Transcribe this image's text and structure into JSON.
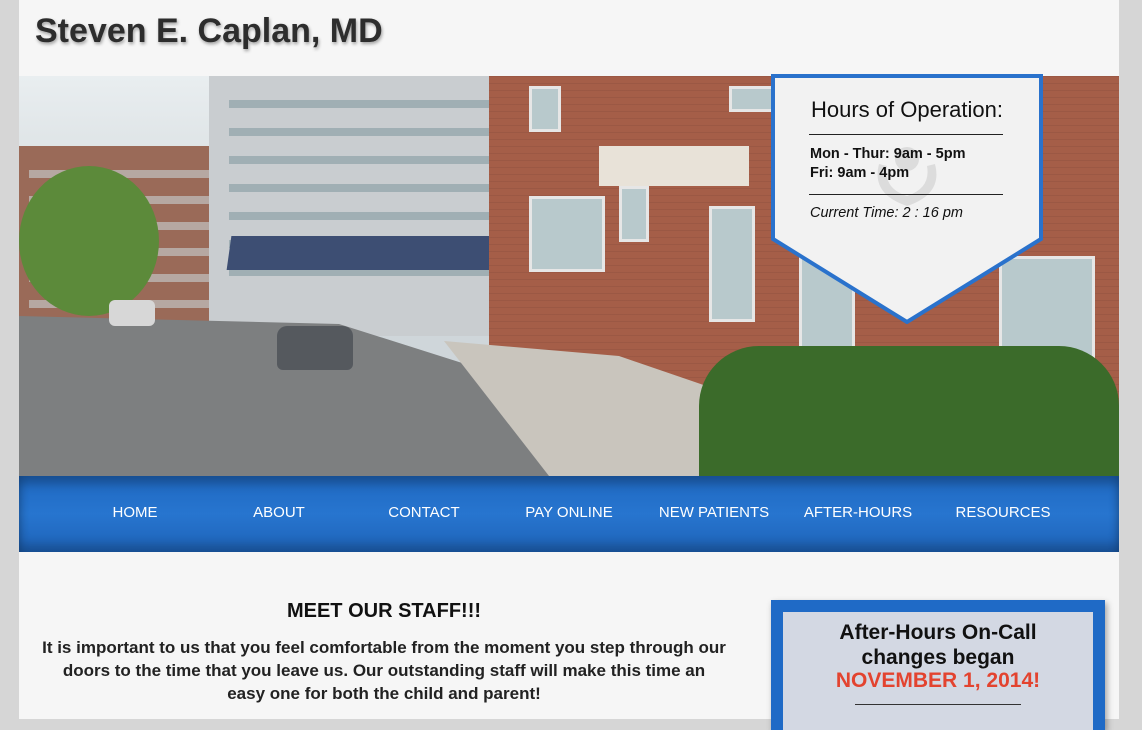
{
  "site": {
    "title": "Steven E. Caplan, MD"
  },
  "hours": {
    "title": "Hours of Operation:",
    "lines": [
      "Mon - Thur: 9am - 5pm",
      "Fri: 9am - 4pm"
    ],
    "current_time": "Current Time: 2 : 16 pm"
  },
  "nav": {
    "items": [
      {
        "label": "HOME"
      },
      {
        "label": "ABOUT"
      },
      {
        "label": "CONTACT"
      },
      {
        "label": "PAY ONLINE"
      },
      {
        "label": "NEW PATIENTS"
      },
      {
        "label": "AFTER-HOURS"
      },
      {
        "label": "RESOURCES"
      }
    ]
  },
  "staff": {
    "heading": "MEET OUR STAFF!!!",
    "text": "It is important to us that you feel comfortable from the moment you step through our doors to the time that you leave us. Our outstanding staff will make this time an easy one for both the child and parent!"
  },
  "oncall": {
    "line1": "After-Hours On-Call",
    "line2": "changes began",
    "line3": "NOVEMBER 1, 2014!"
  },
  "colors": {
    "nav_blue": "#2775cf",
    "accent_red": "#e3432f",
    "badge_border": "#2a72cc"
  }
}
